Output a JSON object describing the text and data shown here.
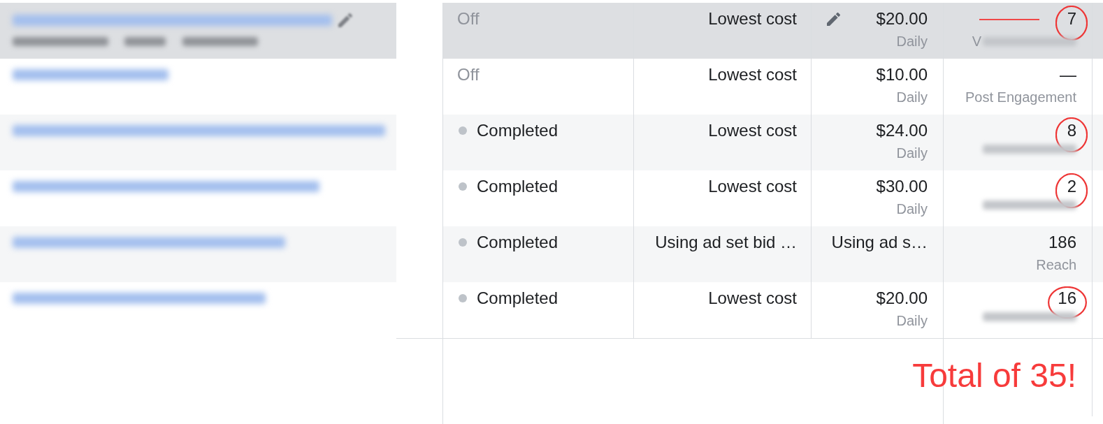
{
  "rows": [
    {
      "hovered": true,
      "delivery": {
        "kind": "off",
        "label": "Off"
      },
      "bid_strategy": "Lowest cost",
      "budget": {
        "amount": "$20.00",
        "period": "Daily"
      },
      "result": {
        "value": "7",
        "label": "V",
        "label_blurred": true,
        "circled": true,
        "line_mark": true
      }
    },
    {
      "hovered": false,
      "delivery": {
        "kind": "off",
        "label": "Off"
      },
      "bid_strategy": "Lowest cost",
      "budget": {
        "amount": "$10.00",
        "period": "Daily"
      },
      "result": {
        "value": "—",
        "label": "Post Engagement",
        "label_blurred": false,
        "circled": false,
        "line_mark": false
      }
    },
    {
      "hovered": false,
      "delivery": {
        "kind": "completed",
        "label": "Completed"
      },
      "bid_strategy": "Lowest cost",
      "budget": {
        "amount": "$24.00",
        "period": "Daily"
      },
      "result": {
        "value": "8",
        "label_blurred": true,
        "circled": true,
        "line_mark": false
      }
    },
    {
      "hovered": false,
      "delivery": {
        "kind": "completed",
        "label": "Completed"
      },
      "bid_strategy": "Lowest cost",
      "budget": {
        "amount": "$30.00",
        "period": "Daily"
      },
      "result": {
        "value": "2",
        "label_blurred": true,
        "circled": true,
        "line_mark": false
      }
    },
    {
      "hovered": false,
      "delivery": {
        "kind": "completed",
        "label": "Completed"
      },
      "bid_strategy": "Using ad set bid …",
      "budget": {
        "amount": "Using ad s…"
      },
      "result": {
        "value": "186",
        "label": "Reach",
        "label_blurred": false,
        "circled": false,
        "line_mark": false
      }
    },
    {
      "hovered": false,
      "delivery": {
        "kind": "completed",
        "label": "Completed"
      },
      "bid_strategy": "Lowest cost",
      "budget": {
        "amount": "$20.00",
        "period": "Daily"
      },
      "result": {
        "value": "16",
        "label_blurred": true,
        "circled": true,
        "line_mark": false
      }
    }
  ],
  "annotation": {
    "text": "Total of 35!"
  }
}
